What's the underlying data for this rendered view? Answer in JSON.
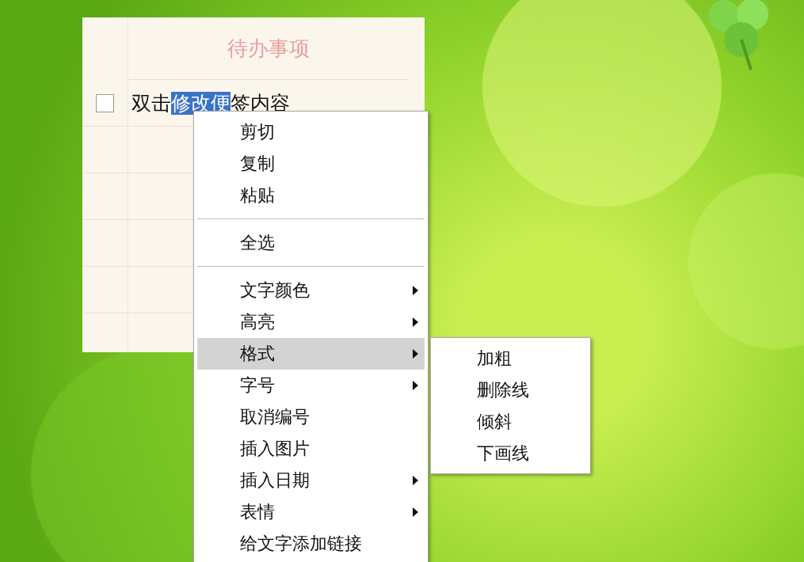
{
  "note": {
    "title": "待办事项",
    "items": [
      {
        "checked": false,
        "text_before": "双击",
        "selection": "修改便",
        "text_after": "签内容"
      }
    ]
  },
  "context_menu": {
    "items": [
      {
        "kind": "item",
        "label": "剪切",
        "submenu": false,
        "selected": false
      },
      {
        "kind": "item",
        "label": "复制",
        "submenu": false,
        "selected": false
      },
      {
        "kind": "item",
        "label": "粘贴",
        "submenu": false,
        "selected": false
      },
      {
        "kind": "separator"
      },
      {
        "kind": "item",
        "label": "全选",
        "submenu": false,
        "selected": false
      },
      {
        "kind": "separator"
      },
      {
        "kind": "item",
        "label": "文字颜色",
        "submenu": true,
        "selected": false
      },
      {
        "kind": "item",
        "label": "高亮",
        "submenu": true,
        "selected": false
      },
      {
        "kind": "item",
        "label": "格式",
        "submenu": true,
        "selected": true
      },
      {
        "kind": "item",
        "label": "字号",
        "submenu": true,
        "selected": false
      },
      {
        "kind": "item",
        "label": "取消编号",
        "submenu": false,
        "selected": false
      },
      {
        "kind": "item",
        "label": "插入图片",
        "submenu": false,
        "selected": false
      },
      {
        "kind": "item",
        "label": "插入日期",
        "submenu": true,
        "selected": false
      },
      {
        "kind": "item",
        "label": "表情",
        "submenu": true,
        "selected": false
      },
      {
        "kind": "item",
        "label": "给文字添加链接",
        "submenu": false,
        "selected": false
      }
    ]
  },
  "submenu": {
    "items": [
      {
        "label": "加粗",
        "selected": false
      },
      {
        "label": "删除线",
        "selected": false
      },
      {
        "label": "倾斜",
        "selected": false
      },
      {
        "label": "下画线",
        "selected": false
      }
    ]
  }
}
